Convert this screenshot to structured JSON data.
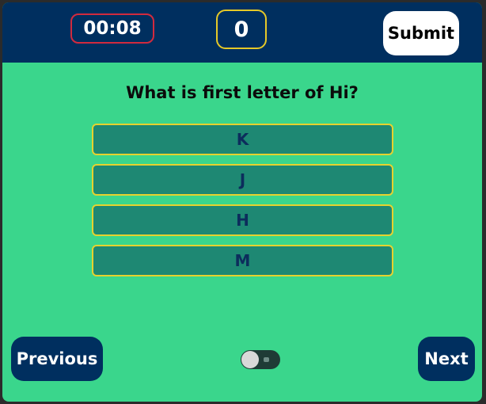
{
  "header": {
    "timer": "00:08",
    "score": "0",
    "submit_label": "Submit"
  },
  "quiz": {
    "question": "What is first letter of Hi?",
    "options": [
      "K",
      "J",
      "H",
      "M"
    ]
  },
  "nav": {
    "previous_label": "Previous",
    "next_label": "Next"
  },
  "toggle": {
    "state": "off"
  },
  "colors": {
    "background": "#3ad68c",
    "header": "#002f5f",
    "option_fill": "#1e8873",
    "option_border": "#e6d22e",
    "timer_border": "#d22a3e",
    "score_border": "#e6c928"
  }
}
